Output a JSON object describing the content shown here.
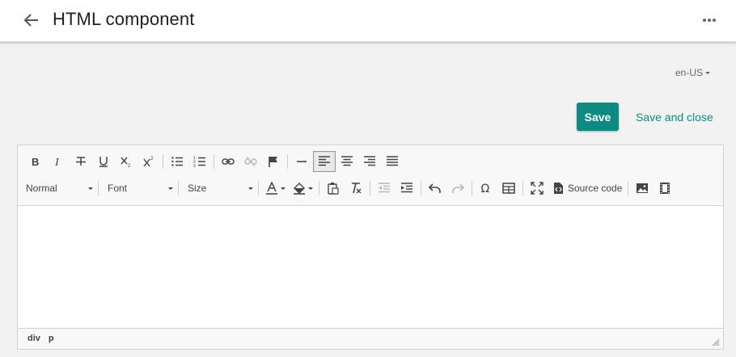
{
  "header": {
    "back_icon": "arrow-left-icon",
    "title": "HTML component",
    "more_icon": "more-horizontal-icon"
  },
  "locale": {
    "label": "en-US"
  },
  "actions": {
    "save_label": "Save",
    "save_close_label": "Save and close"
  },
  "colors": {
    "accent": "#0f8a83",
    "header_bg": "#ffffff",
    "page_bg": "#f2f2f2"
  },
  "toolbar": {
    "row1": [
      "bold-icon",
      "italic-icon",
      "strikethrough-icon",
      "underline-icon",
      "subscript-icon",
      "superscript-icon",
      "bulleted-list-icon",
      "numbered-list-icon",
      "link-icon",
      "unlink-icon",
      "anchor-flag-icon",
      "horizontal-line-icon",
      "align-left-icon",
      "align-center-icon",
      "align-right-icon",
      "justify-icon"
    ],
    "format_label": "Normal",
    "font_label": "Font",
    "size_label": "Size",
    "source_code_label": "Source code"
  },
  "statusbar": {
    "path": [
      "div",
      "p"
    ]
  }
}
